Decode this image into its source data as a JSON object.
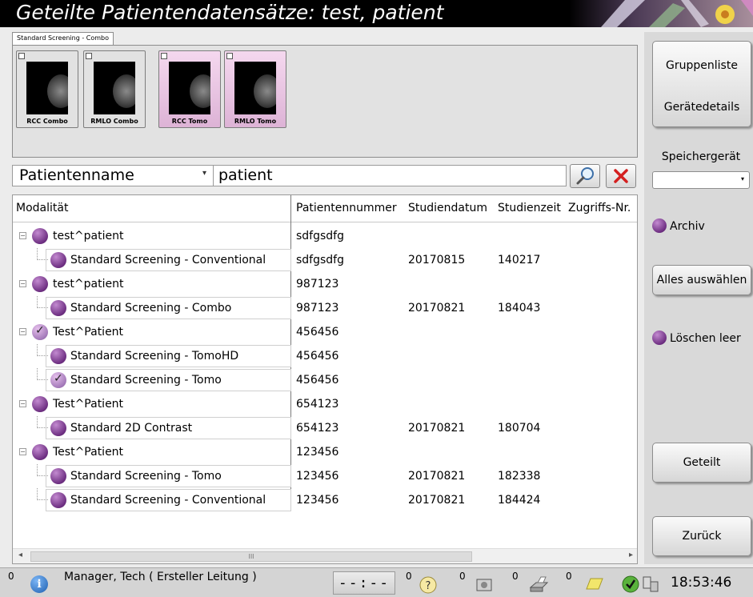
{
  "title": "Geteilte Patientendatensätze: test, patient",
  "tab": "Standard Screening - Combo",
  "thumbnails": [
    {
      "label": "RCC Combo",
      "color": "gray"
    },
    {
      "label": "RMLO Combo",
      "color": "gray"
    },
    {
      "label": "RCC Tomo",
      "color": "pink"
    },
    {
      "label": "RMLO Tomo",
      "color": "pink"
    }
  ],
  "search": {
    "field": "Patientenname",
    "value": "patient"
  },
  "table": {
    "headers": [
      "Modalität",
      "Patientennummer",
      "Studiendatum",
      "Studienzeit",
      "Zugriffs-Nr."
    ],
    "rows": [
      {
        "name": "test^patient",
        "level": 0,
        "checked": false,
        "id": "sdfgsdfg",
        "date": "",
        "time": ""
      },
      {
        "name": "Standard Screening - Conventional",
        "level": 1,
        "checked": false,
        "id": "sdfgsdfg",
        "date": "20170815",
        "time": "140217"
      },
      {
        "name": "test^patient",
        "level": 0,
        "checked": false,
        "id": "987123",
        "date": "",
        "time": ""
      },
      {
        "name": "Standard Screening - Combo",
        "level": 1,
        "checked": false,
        "id": "987123",
        "date": "20170821",
        "time": "184043"
      },
      {
        "name": "Test^Patient",
        "level": 0,
        "checked": true,
        "id": "456456",
        "date": "",
        "time": ""
      },
      {
        "name": "Standard Screening - TomoHD",
        "level": 1,
        "checked": false,
        "id": "456456",
        "date": "",
        "time": ""
      },
      {
        "name": "Standard Screening - Tomo",
        "level": 1,
        "checked": true,
        "id": "456456",
        "date": "",
        "time": ""
      },
      {
        "name": "Test^Patient",
        "level": 0,
        "checked": false,
        "id": "654123",
        "date": "",
        "time": ""
      },
      {
        "name": "Standard 2D Contrast",
        "level": 1,
        "checked": false,
        "id": "654123",
        "date": "20170821",
        "time": "180704"
      },
      {
        "name": "Test^Patient",
        "level": 0,
        "checked": false,
        "id": "123456",
        "date": "",
        "time": ""
      },
      {
        "name": "Standard Screening - Tomo",
        "level": 1,
        "checked": false,
        "id": "123456",
        "date": "20170821",
        "time": "182338"
      },
      {
        "name": "Standard Screening - Conventional",
        "level": 1,
        "checked": false,
        "id": "123456",
        "date": "20170821",
        "time": "184424"
      }
    ],
    "scroll_thumb": "III"
  },
  "sidebar": {
    "gruppenliste": "Gruppenliste",
    "geraetedetails": "Gerätedetails",
    "speicher_label": "Speichergerät",
    "archiv": "Archiv",
    "alles_auswaehlen": "Alles auswählen",
    "loeschen_leer": "Löschen leer",
    "geteilt": "Geteilt",
    "zurueck": "Zurück"
  },
  "statusbar": {
    "info_count": "0",
    "user": "Manager, Tech ( Ersteller Leitung )",
    "timer": "--:--",
    "counts": [
      "0",
      "0",
      "0",
      "0"
    ],
    "clock": "18:53:46"
  }
}
